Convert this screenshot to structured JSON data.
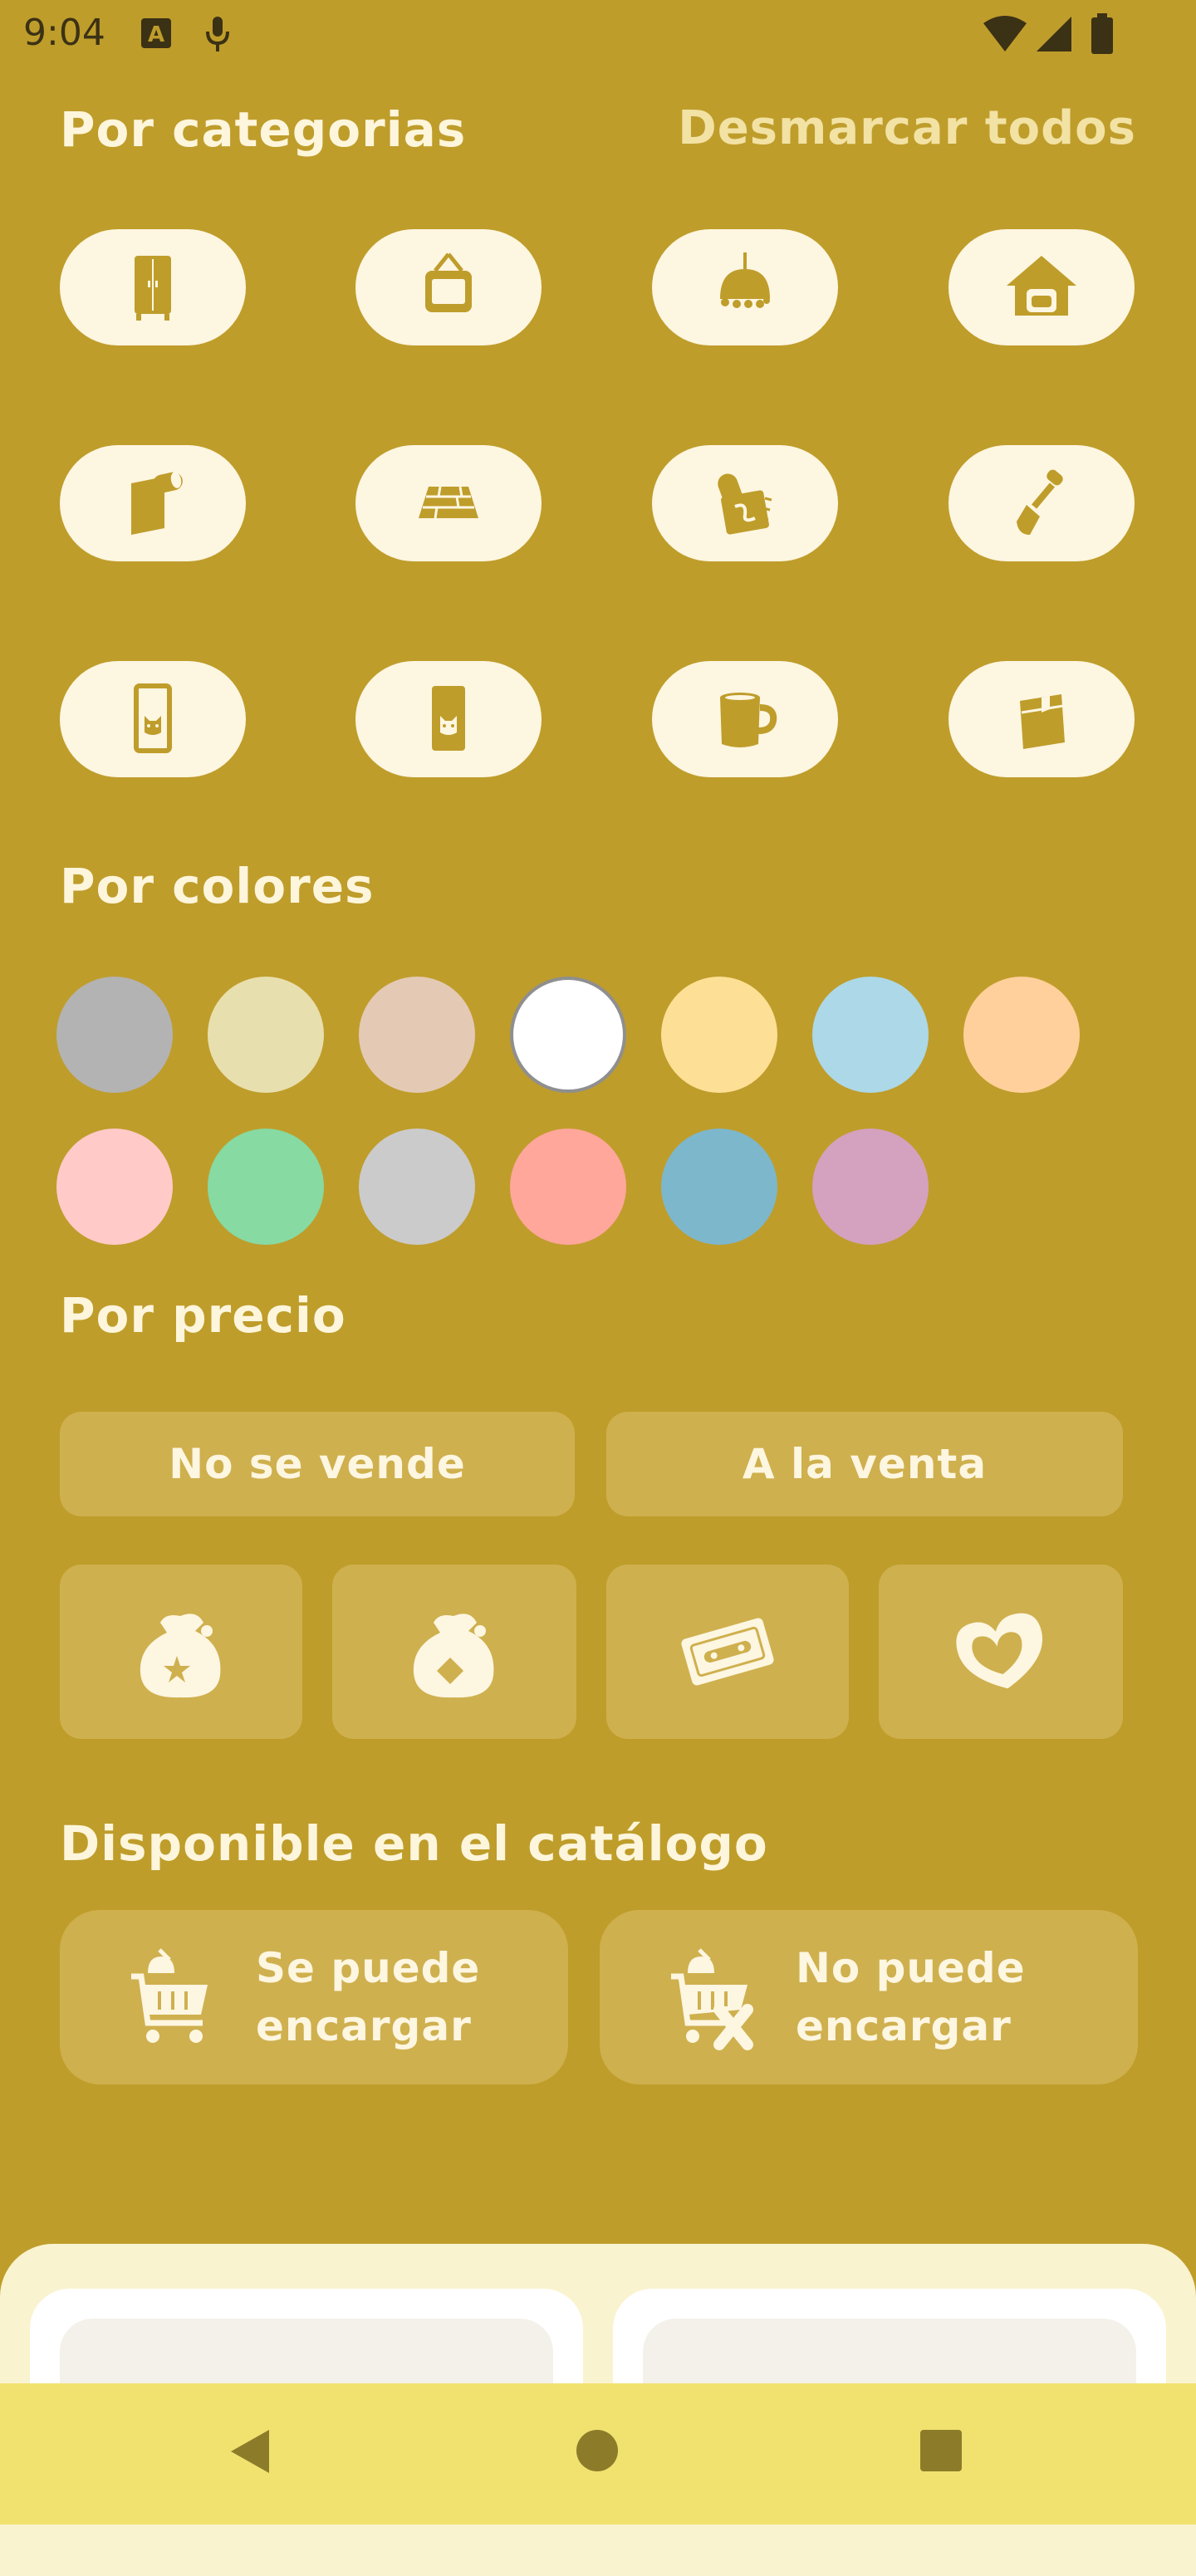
{
  "status_bar": {
    "time": "9:04",
    "icons": [
      "keyboard-a-icon",
      "microphone-icon",
      "wifi-icon",
      "signal-icon",
      "battery-icon"
    ]
  },
  "categories": {
    "title": "Por categorias",
    "clear_all": "Desmarcar todos",
    "items": [
      {
        "icon": "wardrobe-icon"
      },
      {
        "icon": "wall-frame-icon"
      },
      {
        "icon": "ceiling-lamp-icon"
      },
      {
        "icon": "house-interior-icon"
      },
      {
        "icon": "wallpaper-roll-icon"
      },
      {
        "icon": "flooring-icon"
      },
      {
        "icon": "rug-icon"
      },
      {
        "icon": "shovel-icon"
      },
      {
        "icon": "card-outline-icon"
      },
      {
        "icon": "card-filled-icon"
      },
      {
        "icon": "mug-icon"
      },
      {
        "icon": "bag-icon"
      }
    ]
  },
  "colors": {
    "title": "Por colores",
    "swatches": [
      "#b3b3b3",
      "#e8dfae",
      "#e4cab4",
      "#ffffff",
      "#fde095",
      "#acd8e7",
      "#ffd09b",
      "#ffcac8",
      "#86daa2",
      "#cbcbcb",
      "#ffa79b",
      "#7db7cc",
      "#d4a1bf"
    ]
  },
  "price": {
    "title": "Por precio",
    "not_sold": "No se vende",
    "for_sale": "A la venta",
    "currency_icons": [
      "bells-bag-star-icon",
      "bells-bag-icon",
      "nook-miles-ticket-icon",
      "heart-point-icon"
    ]
  },
  "catalog": {
    "title": "Disponible en el catálogo",
    "can_order_line1": "Se puede",
    "can_order_line2": "encargar",
    "cannot_order_line1": "No puede",
    "cannot_order_line2": "encargar"
  },
  "nav": {
    "icons": [
      "back-icon",
      "home-icon",
      "recents-icon"
    ]
  },
  "theme": {
    "background": "#bf9d2b",
    "pill": "#fdf6e1",
    "icon": "#bf9d2b",
    "button": "#cfb04e",
    "navbar": "#f1e26f"
  }
}
